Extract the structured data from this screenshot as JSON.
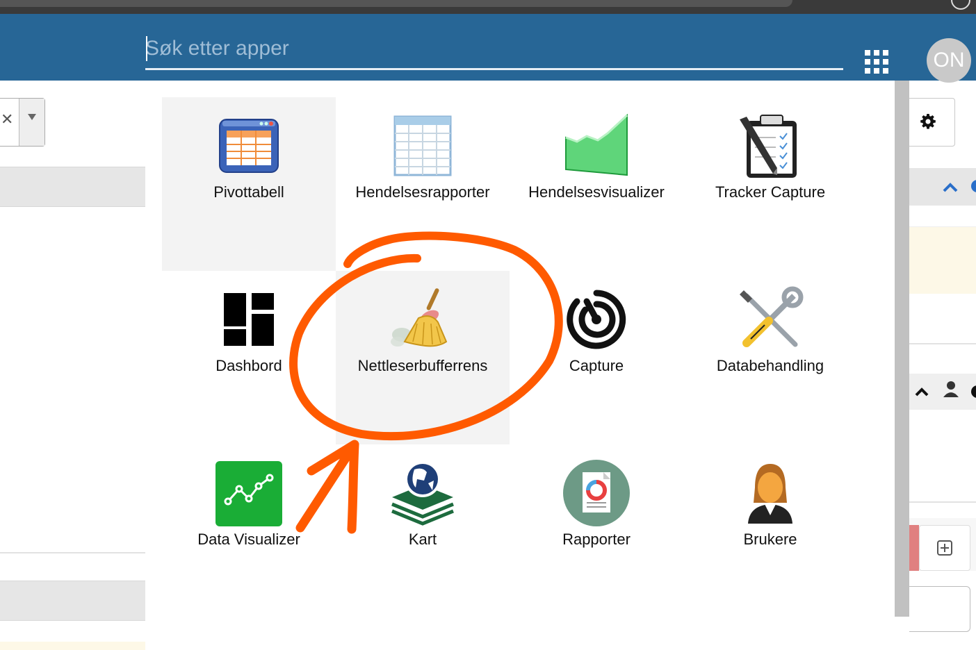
{
  "header": {
    "search_placeholder": "Søk etter apper",
    "avatar_initials": "ON",
    "bar_color": "#276696"
  },
  "apps": [
    {
      "label": "Pivottabell",
      "icon": "pivot-table-icon"
    },
    {
      "label": "Hendelsesrapporter",
      "icon": "table-report-icon"
    },
    {
      "label": "Hendelsesvisualizer",
      "icon": "area-chart-icon"
    },
    {
      "label": "Tracker Capture",
      "icon": "clipboard-pen-icon"
    },
    {
      "label": "Dashbord",
      "icon": "dashboard-icon"
    },
    {
      "label": "Nettleserbufferrens",
      "icon": "broom-icon"
    },
    {
      "label": "Capture",
      "icon": "capture-icon"
    },
    {
      "label": "Databehandling",
      "icon": "tools-icon"
    },
    {
      "label": "Data Visualizer",
      "icon": "line-chart-icon"
    },
    {
      "label": "Kart",
      "icon": "map-globe-icon"
    },
    {
      "label": "Rapporter",
      "icon": "report-icon"
    },
    {
      "label": "Brukere",
      "icon": "user-icon"
    }
  ],
  "annotation_color": "#ff5a00"
}
